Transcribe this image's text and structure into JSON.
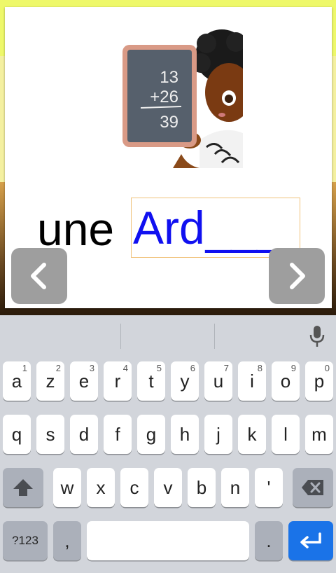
{
  "exercise": {
    "article": "une",
    "typed": "Ard",
    "blanks": "____"
  },
  "illustration": {
    "slate_lines": [
      "13",
      "+26",
      "39"
    ]
  },
  "navigation": {
    "prev_icon": "chevron-left-icon",
    "next_icon": "chevron-right-icon"
  },
  "keyboard": {
    "row1": [
      {
        "label": "a",
        "hint": "1"
      },
      {
        "label": "z",
        "hint": "2"
      },
      {
        "label": "e",
        "hint": "3"
      },
      {
        "label": "r",
        "hint": "4"
      },
      {
        "label": "t",
        "hint": "5"
      },
      {
        "label": "y",
        "hint": "6"
      },
      {
        "label": "u",
        "hint": "7"
      },
      {
        "label": "i",
        "hint": "8"
      },
      {
        "label": "o",
        "hint": "9"
      },
      {
        "label": "p",
        "hint": "0"
      }
    ],
    "row2": [
      "q",
      "s",
      "d",
      "f",
      "g",
      "h",
      "j",
      "k",
      "l",
      "m"
    ],
    "row3": [
      "w",
      "x",
      "c",
      "v",
      "b",
      "n",
      "'"
    ],
    "symbols_label": "?123",
    "comma_label": ",",
    "period_label": ".",
    "mic_icon": "microphone-icon",
    "shift_icon": "shift-icon",
    "backspace_icon": "backspace-icon",
    "enter_icon": "enter-icon"
  },
  "colors": {
    "answer_text": "#1010f0",
    "field_border": "#f0c27a",
    "nav_button": "#9e9e9e",
    "enter_key": "#1a73e8"
  }
}
